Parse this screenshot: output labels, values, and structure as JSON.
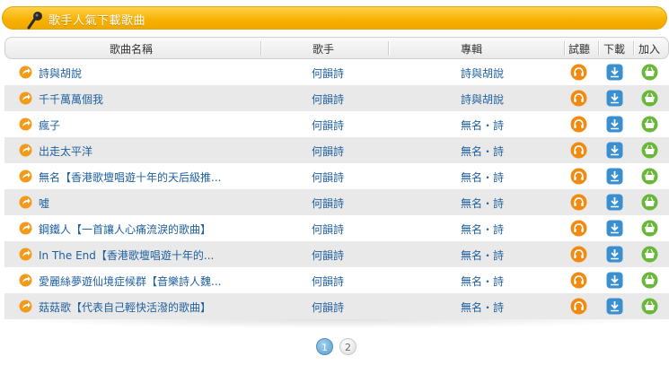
{
  "header": {
    "title": "歌手人氣下載歌曲"
  },
  "table": {
    "columns": {
      "song": "歌曲名稱",
      "singer": "歌手",
      "album": "專輯",
      "listen": "試聽",
      "download": "下載",
      "add": "加入"
    },
    "rows": [
      {
        "song": "詩與胡說",
        "singer": "何韻詩",
        "album": "詩與胡說"
      },
      {
        "song": "千千萬萬個我",
        "singer": "何韻詩",
        "album": "詩與胡說"
      },
      {
        "song": "瘋子",
        "singer": "何韻詩",
        "album": "無名・詩"
      },
      {
        "song": "出走太平洋",
        "singer": "何韻詩",
        "album": "無名・詩"
      },
      {
        "song": "無名【香港歌壇唱遊十年的天后級推...",
        "singer": "何韻詩",
        "album": "無名・詩"
      },
      {
        "song": "噓",
        "singer": "何韻詩",
        "album": "無名・詩"
      },
      {
        "song": "鋼鐵人【一首讓人心痛流淚的歌曲】",
        "singer": "何韻詩",
        "album": "無名・詩"
      },
      {
        "song": "In The End【香港歌壇唱遊十年的...",
        "singer": "何韻詩",
        "album": "無名・詩"
      },
      {
        "song": "愛麗絲夢遊仙境症候群【音樂詩人魏...",
        "singer": "何韻詩",
        "album": "無名・詩"
      },
      {
        "song": "菇菇歌【代表自己輕快活潑的歌曲】",
        "singer": "何韻詩",
        "album": "無名・詩"
      }
    ]
  },
  "pagination": {
    "pages": [
      "1",
      "2"
    ],
    "current": "1"
  },
  "icons": {
    "header": "microphone-icon",
    "row": "arrow-circle-icon",
    "listen": "headphones-icon",
    "download": "download-icon",
    "add": "shopping-basket-icon"
  },
  "colors": {
    "header_bar": "#f7b000",
    "link": "#2060a0",
    "listen_button": "#f08a10",
    "download_button": "#3a8fd0",
    "add_button": "#6ab83a",
    "current_page": "#5a9fd0"
  }
}
